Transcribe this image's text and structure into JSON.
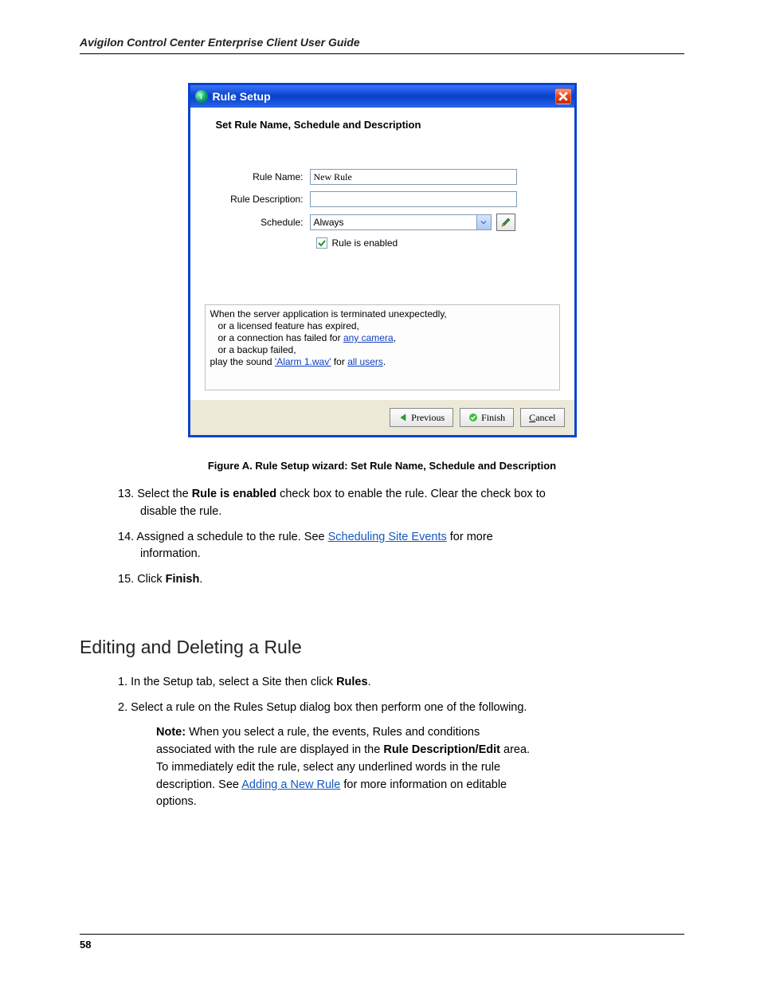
{
  "header": "Avigilon Control Center Enterprise Client User Guide",
  "dialog": {
    "title": "Rule Setup",
    "heading": "Set Rule Name, Schedule and Description",
    "labels": {
      "ruleName": "Rule Name:",
      "ruleDesc": "Rule Description:",
      "schedule": "Schedule:"
    },
    "values": {
      "ruleName": "New Rule",
      "ruleDesc": "",
      "schedule": "Always"
    },
    "checkbox": {
      "label": "Rule is enabled",
      "checked": true
    },
    "summary": {
      "line1": "When the server application is terminated unexpectedly,",
      "line2_pre": "or a licensed feature has expired,",
      "line3_pre": "or a connection has failed for ",
      "line3_link": "any camera",
      "line4": "or a backup failed,",
      "line5_pre": "play the sound ",
      "line5_link1": "'Alarm 1.wav'",
      "line5_mid": " for ",
      "line5_link2": "all users",
      "comma": ",",
      "period": "."
    },
    "buttons": {
      "previous": "Previous",
      "finish": "Finish",
      "cancel": "ancel",
      "cancel_u": "C"
    }
  },
  "figureCaption": "Figure A.   Rule Setup wizard: Set Rule Name, Schedule and Description",
  "steps": {
    "s13": {
      "num": "13.  ",
      "text_a": "Select the ",
      "bold": "Rule is enabled",
      "text_b": " check box to enable the rule. Clear the check box to",
      "text_c": "disable the rule."
    },
    "s14": {
      "num": "14.  ",
      "text_a": "Assigned a schedule to the rule. See ",
      "link": "Scheduling Site Events",
      "text_b": " for more",
      "text_c": "information."
    },
    "s15": {
      "num": "15.  ",
      "text_a": "Click ",
      "bold": "Finish",
      "text_b": "."
    }
  },
  "sectionHeading": "Editing and Deleting a Rule",
  "steps2": {
    "s1": {
      "num": "1.  ",
      "text_a": "In the Setup tab, select a Site then click ",
      "bold": "Rules",
      "text_b": "."
    },
    "s2": {
      "num": "2.  ",
      "text_a": "Select a rule on the Rules Setup dialog box then perform one of the following."
    },
    "note": {
      "bold1": "Note:",
      "text1": " When you select a rule, the events, Rules and conditions",
      "text2": "associated with the rule are displayed in the ",
      "bold2": "Rule Description/Edit",
      "text3": " area.",
      "text4": "To immediately edit the rule, select any underlined words in the rule",
      "text5": "description. See ",
      "link": "Adding a New Rule",
      "text6": " for more information on editable",
      "text7": "options."
    }
  },
  "pageNumber": "58"
}
